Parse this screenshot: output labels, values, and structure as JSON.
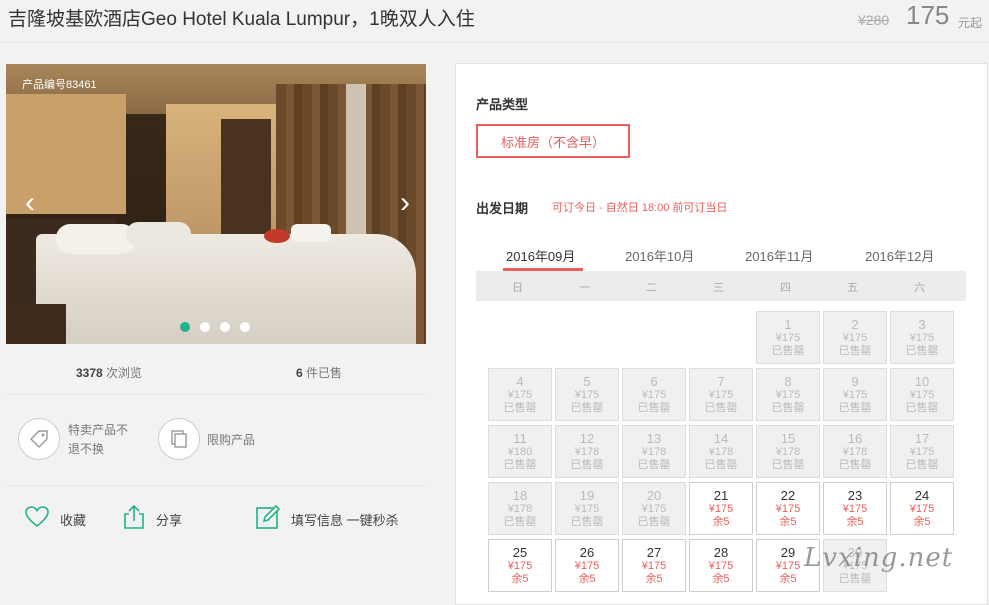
{
  "header": {
    "title": "吉隆坡基欧酒店Geo Hotel Kuala Lumpur，1晚双人入住",
    "original_price": "¥280",
    "price": "175",
    "price_suffix": "元起"
  },
  "gallery": {
    "product_id": "产品编号83461",
    "prev_icon": "chevron-left-icon",
    "next_icon": "chevron-right-icon",
    "dots_total": 4,
    "active_dot": 1
  },
  "stats": {
    "views_count": "3378",
    "views_label": " 次浏览",
    "sold_count": "6",
    "sold_label": " 件已售"
  },
  "notes": [
    {
      "icon": "tag-icon",
      "text": "特卖产品不退不换"
    },
    {
      "icon": "copy-icon",
      "text": "限购产品"
    }
  ],
  "actions": {
    "favorite": {
      "icon": "heart-icon",
      "label": "收藏"
    },
    "share": {
      "icon": "share-icon",
      "label": "分享"
    },
    "fill": {
      "icon": "edit-icon",
      "label": "填写信息 一键秒杀"
    }
  },
  "booking": {
    "type_label": "产品类型",
    "type_option": "标准房（不含早）",
    "date_label": "出发日期",
    "date_note": "可订今日 - 自然日 18:00 前可订当日",
    "months": [
      "2016年09月",
      "2016年10月",
      "2016年11月",
      "2016年12月"
    ],
    "active_month": 0,
    "weekdays": [
      "日",
      "一",
      "二",
      "三",
      "四",
      "五",
      "六"
    ],
    "days": [
      {
        "day": "1",
        "price": "¥175",
        "status": "已售罄",
        "available": false
      },
      {
        "day": "2",
        "price": "¥175",
        "status": "已售罄",
        "available": false
      },
      {
        "day": "3",
        "price": "¥175",
        "status": "已售罄",
        "available": false
      },
      {
        "day": "4",
        "price": "¥175",
        "status": "已售罄",
        "available": false
      },
      {
        "day": "5",
        "price": "¥175",
        "status": "已售罄",
        "available": false
      },
      {
        "day": "6",
        "price": "¥175",
        "status": "已售罄",
        "available": false
      },
      {
        "day": "7",
        "price": "¥175",
        "status": "已售罄",
        "available": false
      },
      {
        "day": "8",
        "price": "¥175",
        "status": "已售罄",
        "available": false
      },
      {
        "day": "9",
        "price": "¥175",
        "status": "已售罄",
        "available": false
      },
      {
        "day": "10",
        "price": "¥175",
        "status": "已售罄",
        "available": false
      },
      {
        "day": "11",
        "price": "¥180",
        "status": "已售罄",
        "available": false
      },
      {
        "day": "12",
        "price": "¥178",
        "status": "已售罄",
        "available": false
      },
      {
        "day": "13",
        "price": "¥178",
        "status": "已售罄",
        "available": false
      },
      {
        "day": "14",
        "price": "¥178",
        "status": "已售罄",
        "available": false
      },
      {
        "day": "15",
        "price": "¥178",
        "status": "已售罄",
        "available": false
      },
      {
        "day": "16",
        "price": "¥178",
        "status": "已售罄",
        "available": false
      },
      {
        "day": "17",
        "price": "¥175",
        "status": "已售罄",
        "available": false
      },
      {
        "day": "18",
        "price": "¥178",
        "status": "已售罄",
        "available": false
      },
      {
        "day": "19",
        "price": "¥175",
        "status": "已售罄",
        "available": false
      },
      {
        "day": "20",
        "price": "¥175",
        "status": "已售罄",
        "available": false
      },
      {
        "day": "21",
        "price": "¥175",
        "status": "余5",
        "available": true
      },
      {
        "day": "22",
        "price": "¥175",
        "status": "余5",
        "available": true
      },
      {
        "day": "23",
        "price": "¥175",
        "status": "余5",
        "available": true
      },
      {
        "day": "24",
        "price": "¥175",
        "status": "余5",
        "available": true
      },
      {
        "day": "25",
        "price": "¥175",
        "status": "余5",
        "available": true
      },
      {
        "day": "26",
        "price": "¥175",
        "status": "余5",
        "available": true
      },
      {
        "day": "27",
        "price": "¥175",
        "status": "余5",
        "available": true
      },
      {
        "day": "28",
        "price": "¥175",
        "status": "余5",
        "available": true
      },
      {
        "day": "29",
        "price": "¥175",
        "status": "余5",
        "available": true
      },
      {
        "day": "30",
        "price": "¥175",
        "status": "已售罄",
        "available": false
      }
    ],
    "first_weekday": 4
  },
  "watermark": "Lvxing.net",
  "colors": {
    "accent": "#e8605a",
    "green": "#1fb28b"
  }
}
